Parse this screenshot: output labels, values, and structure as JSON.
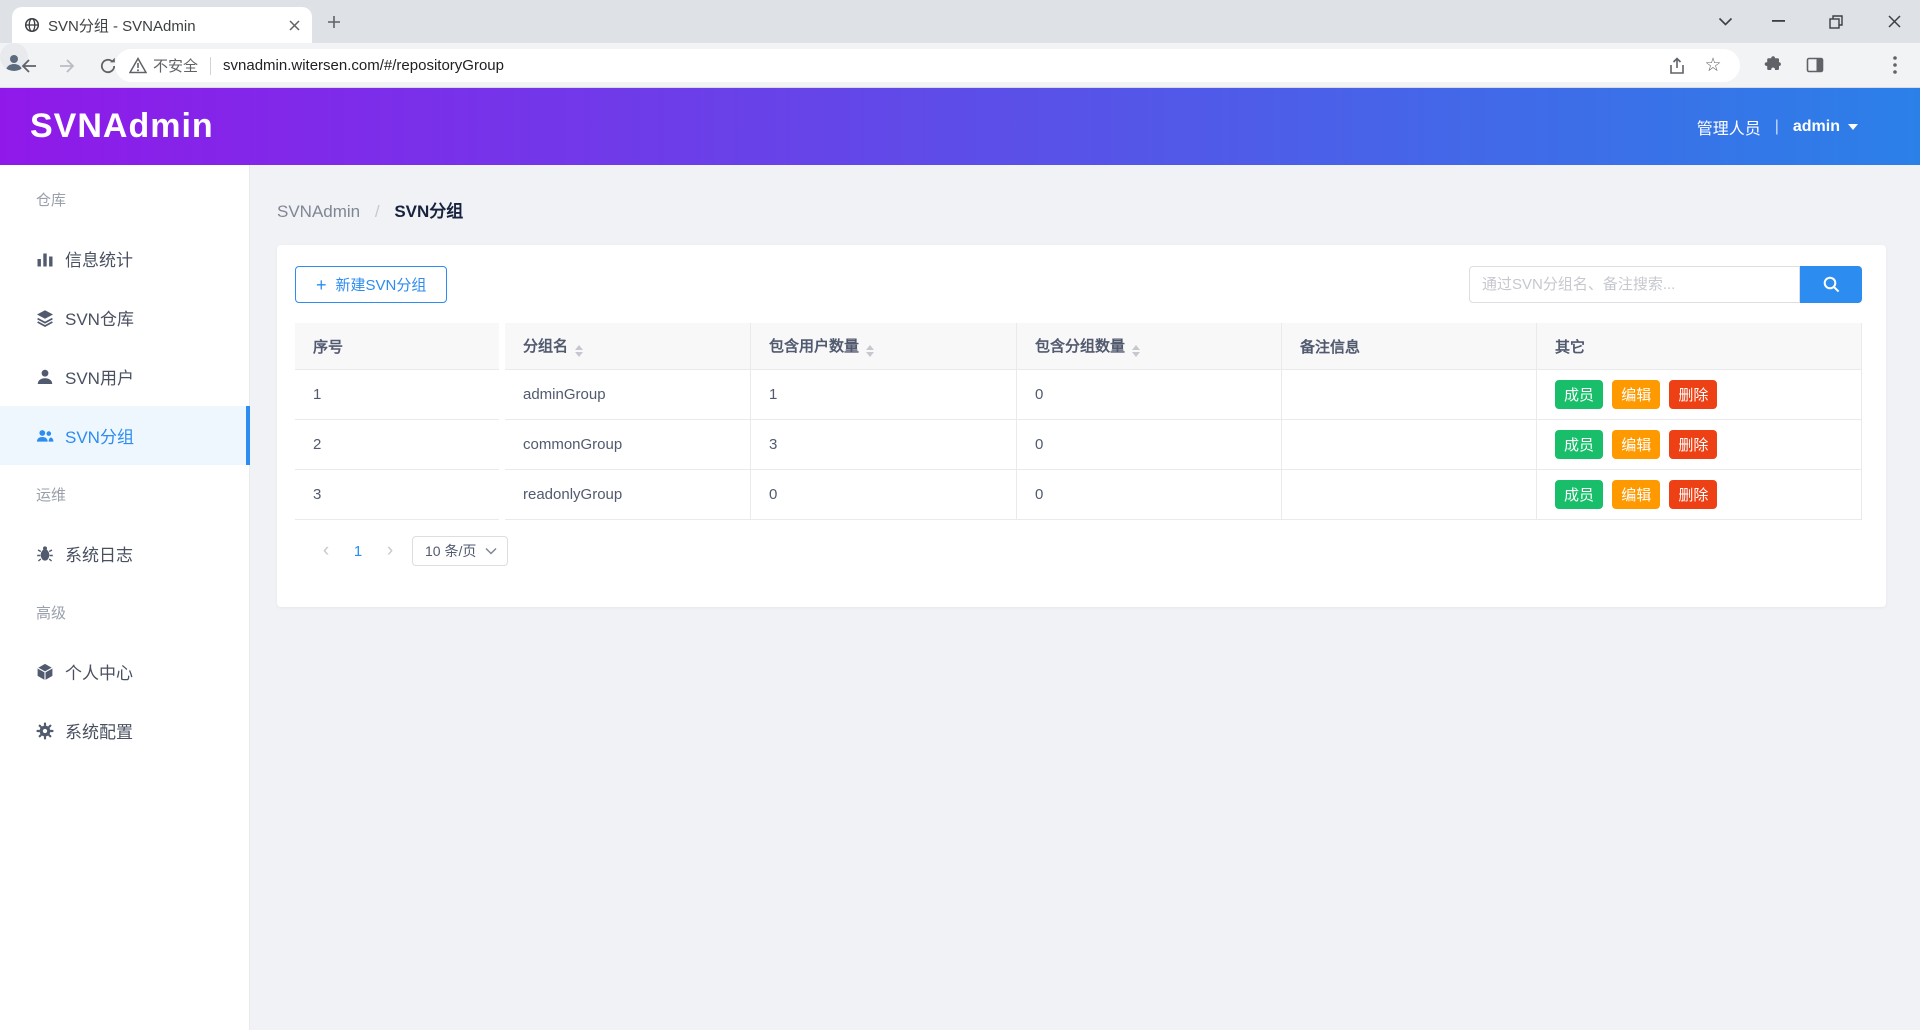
{
  "colors": {
    "primary": "#2d8cf0",
    "success": "#19be6b",
    "warning": "#ff9900",
    "error": "#ed4014",
    "header_gradient_from": "#9019e9",
    "header_gradient_to": "#2b80e8",
    "page_background": "#f0f2f5"
  },
  "browser": {
    "tab_title": "SVN分组 - SVNAdmin",
    "security_label": "不安全",
    "url": "svnadmin.witersen.com/#/repositoryGroup"
  },
  "header": {
    "logo": "SVNAdmin",
    "role": "管理人员",
    "divider": "|",
    "username": "admin"
  },
  "sidebar": {
    "items": [
      {
        "type": "section",
        "label": "仓库"
      },
      {
        "type": "item",
        "icon": "bar-chart-icon",
        "label": "信息统计"
      },
      {
        "type": "item",
        "icon": "layers-icon",
        "label": "SVN仓库"
      },
      {
        "type": "item",
        "icon": "user-icon",
        "label": "SVN用户"
      },
      {
        "type": "item",
        "icon": "users-icon",
        "label": "SVN分组",
        "active": true
      },
      {
        "type": "section",
        "label": "运维"
      },
      {
        "type": "item",
        "icon": "bug-icon",
        "label": "系统日志"
      },
      {
        "type": "section",
        "label": "高级"
      },
      {
        "type": "item",
        "icon": "cube-icon",
        "label": "个人中心"
      },
      {
        "type": "item",
        "icon": "gear-icon",
        "label": "系统配置"
      }
    ]
  },
  "breadcrumb": {
    "root": "SVNAdmin",
    "separator": "/",
    "current": "SVN分组"
  },
  "card": {
    "plus_icon": "+",
    "new_button": "新建SVN分组",
    "search_placeholder": "通过SVN分组名、备注搜索..."
  },
  "table": {
    "columns": [
      {
        "label": "序号",
        "sortable": false
      },
      {
        "label": "分组名",
        "sortable": true
      },
      {
        "label": "包含用户数量",
        "sortable": true
      },
      {
        "label": "包含分组数量",
        "sortable": true
      },
      {
        "label": "备注信息",
        "sortable": false
      },
      {
        "label": "其它",
        "sortable": false
      }
    ],
    "action_labels": {
      "member": "成员",
      "edit": "编辑",
      "delete": "删除"
    },
    "rows": [
      {
        "seq": "1",
        "name": "adminGroup",
        "user_count": "1",
        "group_count": "0",
        "remark": ""
      },
      {
        "seq": "2",
        "name": "commonGroup",
        "user_count": "3",
        "group_count": "0",
        "remark": ""
      },
      {
        "seq": "3",
        "name": "readonlyGroup",
        "user_count": "0",
        "group_count": "0",
        "remark": ""
      }
    ]
  },
  "pagination": {
    "prev": "‹",
    "page": "1",
    "next": "›",
    "page_size": "10 条/页"
  }
}
